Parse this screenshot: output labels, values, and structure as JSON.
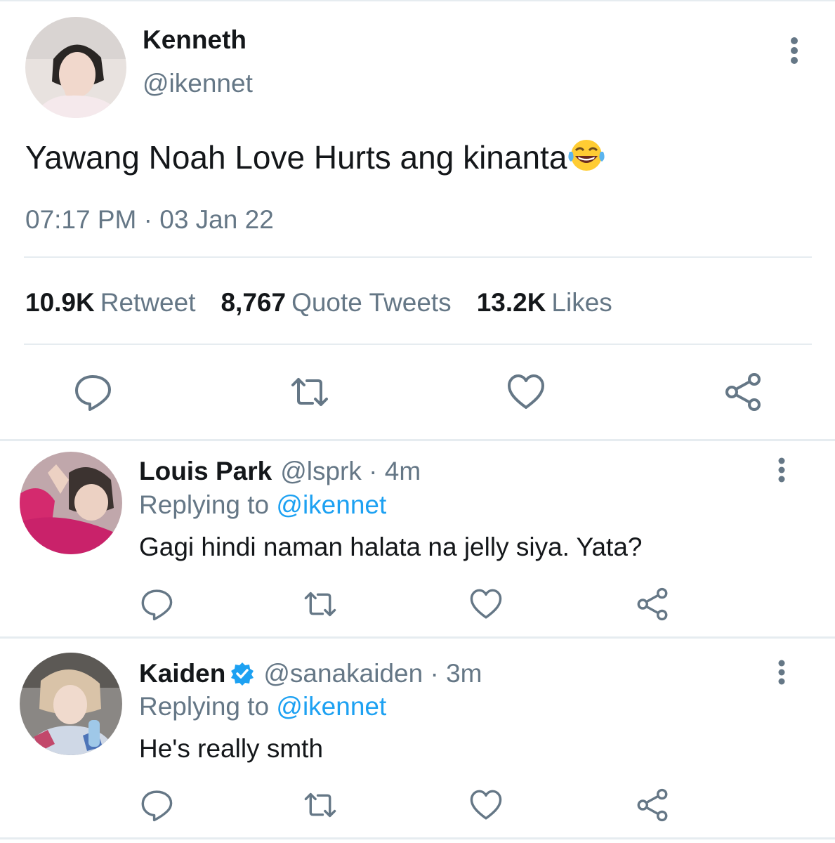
{
  "main_tweet": {
    "author_name": "Kenneth",
    "author_handle": "@ikennet",
    "text": "Yawang Noah Love Hurts ang kinanta",
    "emoji": "face-with-tears-of-joy",
    "timestamp": "07:17 PM · 03 Jan 22",
    "stats": {
      "retweets_count": "10.9K",
      "retweets_label": "Retweet",
      "quotes_count": "8,767",
      "quotes_label": "Quote Tweets",
      "likes_count": "13.2K",
      "likes_label": "Likes"
    }
  },
  "replies": [
    {
      "name": "Louis Park",
      "handle": "@lsprk · 4m",
      "verified": false,
      "replying_prefix": "Replying to",
      "replying_mention": "@ikennet",
      "text": "Gagi hindi naman halata na jelly siya. Yata?"
    },
    {
      "name": "Kaiden",
      "handle": "@sanakaiden · 3m",
      "verified": true,
      "replying_prefix": "Replying to",
      "replying_mention": "@ikennet",
      "text": "He's really smth"
    }
  ],
  "colors": {
    "text_primary": "#14171a",
    "text_secondary": "#657786",
    "link": "#1da1f2",
    "divider": "#e6ecf0",
    "icon": "#657786",
    "verified": "#1da1f2"
  }
}
